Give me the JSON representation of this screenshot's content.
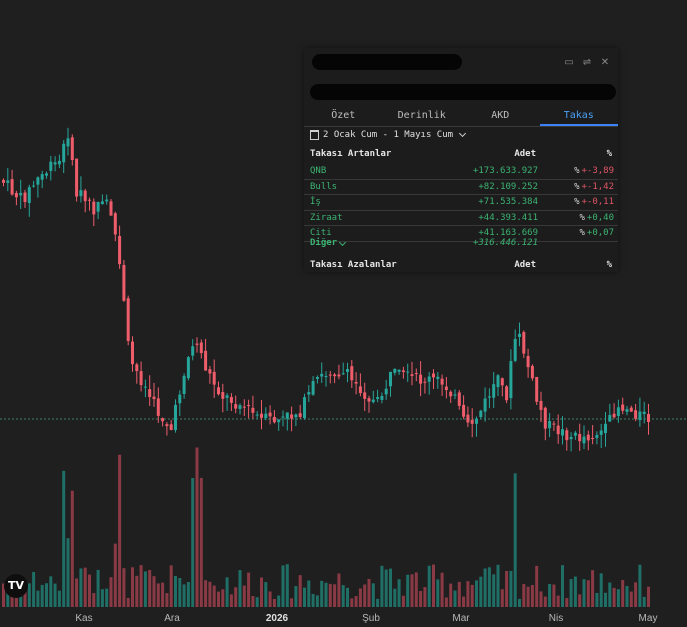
{
  "colors": {
    "background": "#1f1f20",
    "up": "#26a69a",
    "down": "#ef5d6b",
    "tab_active": "#3b82f6",
    "positive_text": "#3cb371",
    "negative_text": "#e05565"
  },
  "chart": {
    "x_labels": [
      "Kas",
      "Ara",
      "2026",
      "Şub",
      "Mar",
      "Nis",
      "May"
    ],
    "logo_text": "TV"
  },
  "panel": {
    "window_icons": [
      "folder-icon",
      "settings-sliders-icon",
      "close-icon"
    ],
    "tabs": [
      {
        "label": "Özet",
        "active": false
      },
      {
        "label": "Derinlik",
        "active": false
      },
      {
        "label": "AKD",
        "active": false
      },
      {
        "label": "Takas",
        "active": true
      }
    ],
    "date_range": "2 Ocak Cum - 1 Mayıs Cum",
    "gainers": {
      "title": "Takası Artanlar",
      "col_amount": "Adet",
      "col_pct": "%",
      "rows": [
        {
          "name": "QNB",
          "amount": "+173.633.927",
          "pct": "+-3,89",
          "positive": false
        },
        {
          "name": "Bulls",
          "amount": "+82.109.252",
          "pct": "+-1,42",
          "positive": false
        },
        {
          "name": "İş",
          "amount": "+71.535.384",
          "pct": "+-0,11",
          "positive": false
        },
        {
          "name": "Ziraat",
          "amount": "+44.393.411",
          "pct": "+0,40",
          "positive": true
        },
        {
          "name": "Citi",
          "amount": "+41.163.669",
          "pct": "+0,07",
          "positive": true
        }
      ],
      "other_label": "Diğer",
      "other_amount": "+316.446.121"
    },
    "losers": {
      "title": "Takası Azalanlar",
      "col_amount": "Adet",
      "col_pct": "%"
    }
  }
}
